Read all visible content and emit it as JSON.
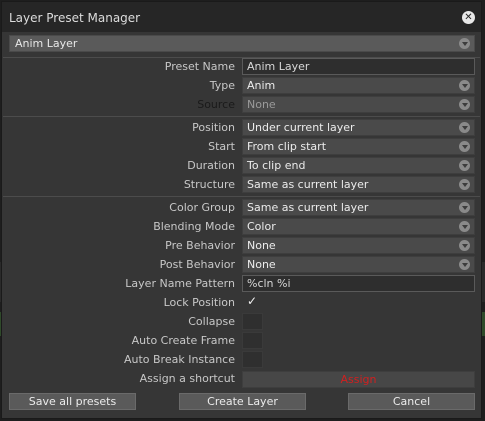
{
  "dialog": {
    "title": "Layer Preset Manager",
    "close_icon": "close-icon",
    "selected_preset": "Anim Layer"
  },
  "fields": {
    "preset_name": {
      "label": "Preset Name",
      "value": "Anim Layer"
    },
    "type": {
      "label": "Type",
      "value": "Anim"
    },
    "source": {
      "label": "Source",
      "value": "None"
    },
    "position": {
      "label": "Position",
      "value": "Under current layer"
    },
    "start": {
      "label": "Start",
      "value": "From clip start"
    },
    "duration": {
      "label": "Duration",
      "value": "To clip end"
    },
    "structure": {
      "label": "Structure",
      "value": "Same as current layer"
    },
    "color_group": {
      "label": "Color Group",
      "value": "Same as current layer"
    },
    "blending_mode": {
      "label": "Blending Mode",
      "value": "Color"
    },
    "pre_behavior": {
      "label": "Pre Behavior",
      "value": "None"
    },
    "post_behavior": {
      "label": "Post Behavior",
      "value": "None"
    },
    "layer_name_pattern": {
      "label": "Layer Name Pattern",
      "value": "%cln %i"
    },
    "lock_position": {
      "label": "Lock Position",
      "checked": true
    },
    "collapse": {
      "label": "Collapse",
      "checked": false
    },
    "auto_create_frame": {
      "label": "Auto Create Frame",
      "checked": false
    },
    "auto_break_instance": {
      "label": "Auto Break Instance",
      "checked": false
    },
    "assign_shortcut": {
      "label": "Assign a shortcut",
      "button": "Assign"
    }
  },
  "buttons": {
    "save_all": "Save all presets",
    "create_layer": "Create Layer",
    "cancel": "Cancel"
  },
  "colors": {
    "dialog_bg": "#363636",
    "titlebar_bg": "#262626",
    "assign_text": "#d02020"
  }
}
